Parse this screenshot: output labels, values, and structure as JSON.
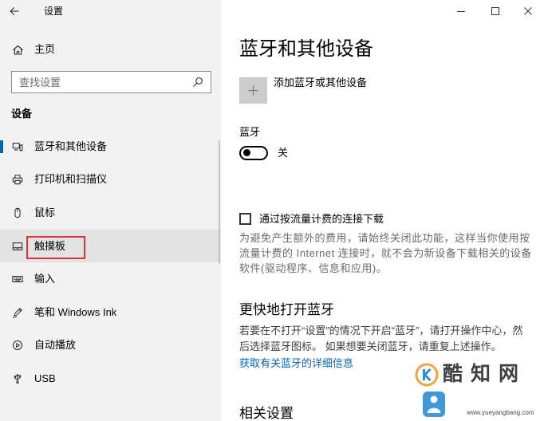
{
  "window": {
    "title": "设置",
    "back_icon": "back-arrow-icon",
    "controls": [
      "minimize-icon",
      "maximize-icon",
      "close-icon"
    ]
  },
  "sidebar": {
    "home_label": "主页",
    "home_icon": "home-icon",
    "search_placeholder": "查找设置",
    "search_icon": "search-icon",
    "section_title": "设备",
    "items": [
      {
        "label": "蓝牙和其他设备",
        "icon": "devices-icon",
        "selected": true
      },
      {
        "label": "打印机和扫描仪",
        "icon": "printer-icon"
      },
      {
        "label": "鼠标",
        "icon": "mouse-icon"
      },
      {
        "label": "触摸板",
        "icon": "touchpad-icon",
        "hovered": true,
        "annotated": true
      },
      {
        "label": "输入",
        "icon": "keyboard-icon"
      },
      {
        "label": "笔和 Windows Ink",
        "icon": "pen-icon"
      },
      {
        "label": "自动播放",
        "icon": "autoplay-icon"
      },
      {
        "label": "USB",
        "icon": "usb-icon"
      }
    ]
  },
  "main": {
    "title": "蓝牙和其他设备",
    "add_device_label": "添加蓝牙或其他设备",
    "add_device_icon": "plus-icon",
    "bluetooth": {
      "label": "蓝牙",
      "state_label": "关",
      "on": false
    },
    "metered": {
      "label": "通过按流量计费的连接下载",
      "checked": false,
      "description_lines": [
        "为避免产生额外的费用，请始终关闭此功能，这样当你使用按",
        "流量计费的 Internet 连接时，就不会为新设备下载相关的设备",
        "软件(驱动程序、信息和应用)。"
      ]
    },
    "quick_open": {
      "heading": "更快地打开蓝牙",
      "lines": [
        "若要在不打开“设置”的情况下开启“蓝牙”，请打开操作中心，然",
        "后选择蓝牙图标。 如果想要关闭蓝牙，请重复上述操作。"
      ],
      "link": "获取有关蓝牙的详细信息"
    },
    "related_heading": "相关设置"
  },
  "watermark": {
    "brand": "酷知网",
    "url": "www.yueyangbang.com"
  },
  "colors": {
    "accent": "#0067b8",
    "sidebar_background": "#f2f2f2",
    "hover_background": "#e3e3e3",
    "annotation_border": "#d6353b"
  }
}
